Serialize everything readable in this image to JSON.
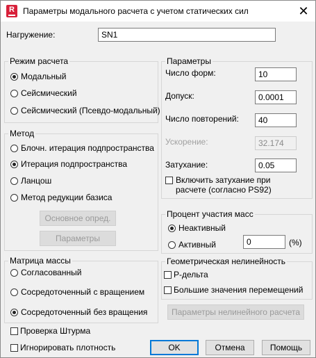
{
  "window": {
    "title": "Параметры модального расчета с учетом статических сил",
    "close_glyph": "✕",
    "app_icon": "R"
  },
  "load": {
    "label": "Нагружение:",
    "value": "SN1"
  },
  "mode_group": {
    "title": "Режим расчета",
    "options": [
      "Модальный",
      "Сейсмический",
      "Сейсмический (Псевдо-модальный)"
    ],
    "selected": 0
  },
  "method_group": {
    "title": "Метод",
    "options": [
      "Блочн. итерация подпространства",
      "Итерация подпространства",
      "Ланцош",
      "Метод редукции базиса"
    ],
    "selected": 1,
    "btn_basic": "Основное опред.",
    "btn_params": "Параметры"
  },
  "params_group": {
    "title": "Параметры",
    "modes_label": "Число форм:",
    "modes_value": "10",
    "tolerance_label": "Допуск:",
    "tolerance_value": "0.0001",
    "iterations_label": "Число повторений:",
    "iterations_value": "40",
    "accel_label": "Ускорение:",
    "accel_value": "32.174",
    "damping_label": "Затухание:",
    "damping_value": "0.05",
    "include_damping_line1": "Включить затухание при",
    "include_damping_line2": "расчете (согласно PS92)"
  },
  "mass_part_group": {
    "title": "Процент участия масс",
    "inactive": "Неактивный",
    "active": "Активный",
    "value": "0",
    "unit": "(%)"
  },
  "mass_matrix_group": {
    "title": "Матрица массы",
    "options": [
      "Согласованный",
      "Сосредоточенный с вращением",
      "Сосредоточенный без вращения"
    ],
    "selected": 2
  },
  "geom_group": {
    "title": "Геометрическая нелинейность",
    "p_delta": "Р-дельта",
    "large_disp": "Большие значения перемещений",
    "btn_nonlinear": "Параметры нелинейного расчета"
  },
  "sturm_check": "Проверка Штурма",
  "ignore_density": "Игнорировать плотность",
  "buttons": {
    "ok": "OK",
    "cancel": "Отмена",
    "help": "Помощь"
  }
}
